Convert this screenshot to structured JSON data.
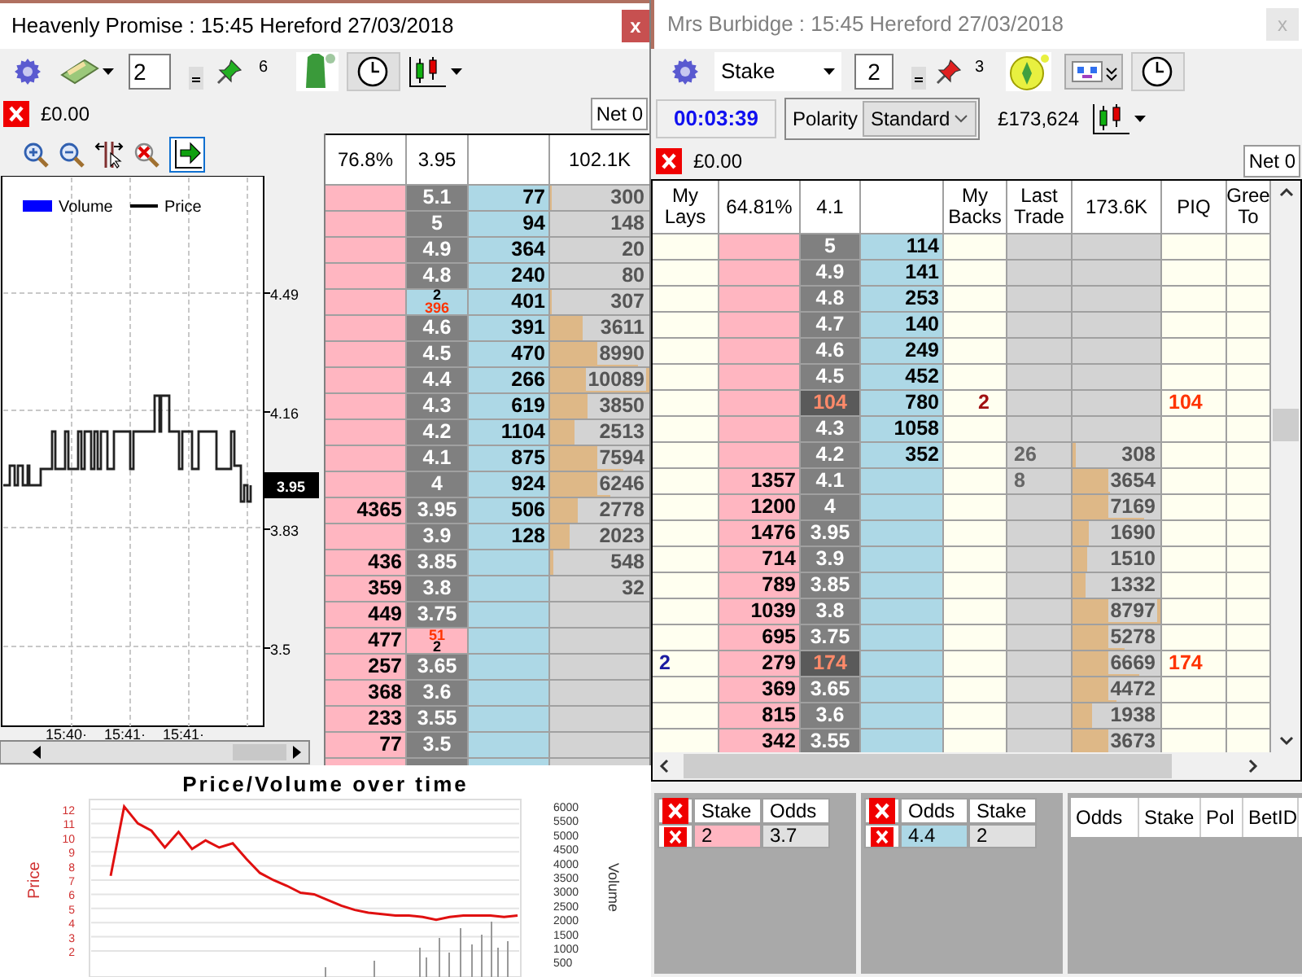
{
  "left_window": {
    "title": "Heavenly Promise : 15:45 Hereford 27/03/2018",
    "close": "x",
    "stake_value": "2",
    "pin_count": "6",
    "exposure": "£0.00",
    "net": "Net 0",
    "chart": {
      "legend": [
        "Volume",
        "Price"
      ],
      "y_ticks": [
        "4.49",
        "4.16",
        "3.83",
        "3.5"
      ],
      "current_price": "3.95",
      "x_ticks": [
        "15:40·",
        "15:41·",
        "15:41·"
      ]
    },
    "ladder": {
      "header": {
        "lay_pct": "76.8%",
        "ltp": "3.95",
        "volume": "102.1K"
      },
      "rows": [
        {
          "odds": {
            "kind": "price",
            "text": "5.1"
          },
          "back": "77",
          "volume": "300",
          "level": 0.02
        },
        {
          "odds": {
            "kind": "price",
            "text": "5"
          },
          "back": "94",
          "volume": "148"
        },
        {
          "odds": {
            "kind": "price",
            "text": "4.9"
          },
          "back": "364",
          "volume": "20"
        },
        {
          "odds": {
            "kind": "price",
            "text": "4.8"
          },
          "back": "240",
          "volume": "80"
        },
        {
          "odds": {
            "kind": "back_order",
            "stake": "2",
            "queue": "396"
          },
          "back": "401",
          "volume": "307",
          "level": 0.02
        },
        {
          "odds": {
            "kind": "price",
            "text": "4.6"
          },
          "back": "391",
          "volume": "3611",
          "level": 0.33
        },
        {
          "odds": {
            "kind": "price",
            "text": "4.5"
          },
          "back": "470",
          "volume": "8990",
          "level": 0.88
        },
        {
          "odds": {
            "kind": "price",
            "text": "4.4"
          },
          "back": "266",
          "volume": "10089",
          "level": 1
        },
        {
          "odds": {
            "kind": "price",
            "text": "4.3"
          },
          "back": "619",
          "volume": "3850",
          "level": 0.37
        },
        {
          "odds": {
            "kind": "price",
            "text": "4.2"
          },
          "back": "1104",
          "volume": "2513",
          "level": 0.24
        },
        {
          "odds": {
            "kind": "price",
            "text": "4.1"
          },
          "back": "875",
          "volume": "7594",
          "level": 0.73
        },
        {
          "odds": {
            "kind": "price",
            "text": "4"
          },
          "back": "924",
          "volume": "6246",
          "level": 0.6
        },
        {
          "lay": "4365",
          "odds": {
            "kind": "price",
            "text": "3.95"
          },
          "back": "506",
          "volume": "2778",
          "level": 0.28
        },
        {
          "odds": {
            "kind": "price",
            "text": "3.9"
          },
          "back": "128",
          "volume": "2023",
          "level": 0.19
        },
        {
          "lay": "436",
          "odds": {
            "kind": "price",
            "text": "3.85"
          },
          "volume": "548",
          "level": 0.04
        },
        {
          "lay": "359",
          "odds": {
            "kind": "price",
            "text": "3.8"
          },
          "volume": "32"
        },
        {
          "lay": "449",
          "odds": {
            "kind": "price",
            "text": "3.75"
          }
        },
        {
          "lay": "477",
          "odds": {
            "kind": "lay_order",
            "stake": "2",
            "queue": "51"
          }
        },
        {
          "lay": "257",
          "odds": {
            "kind": "price",
            "text": "3.65"
          }
        },
        {
          "lay": "368",
          "odds": {
            "kind": "price",
            "text": "3.6"
          }
        },
        {
          "lay": "233",
          "odds": {
            "kind": "price",
            "text": "3.55"
          }
        },
        {
          "lay": "77",
          "odds": {
            "kind": "price",
            "text": "3.5"
          }
        }
      ]
    }
  },
  "right_window": {
    "title": "Mrs Burbidge : 15:45 Hereford 27/03/2018",
    "close": "x",
    "stake_type": "Stake",
    "stake_value": "2",
    "pin_count": "3",
    "timer": "00:03:39",
    "polarity_label": "Polarity",
    "polarity": "Standard",
    "balance": "£173,624",
    "exposure": "£0.00",
    "net": "Net 0",
    "ladder": {
      "header": {
        "my_lays": "My Lays",
        "lay_pct": "64.81%",
        "ltp": "4.1",
        "my_backs": "My Backs",
        "last_trade": "Last Trade",
        "volume": "173.6K",
        "piq": "PIQ",
        "green": "Gree To"
      },
      "rows": [
        {
          "odds": {
            "kind": "price",
            "text": "5"
          },
          "back": "114"
        },
        {
          "odds": {
            "kind": "price",
            "text": "4.9"
          },
          "back": "141"
        },
        {
          "odds": {
            "kind": "price",
            "text": "4.8"
          },
          "back": "253"
        },
        {
          "odds": {
            "kind": "price",
            "text": "4.7"
          },
          "back": "140"
        },
        {
          "odds": {
            "kind": "price",
            "text": "4.6"
          },
          "back": "249"
        },
        {
          "odds": {
            "kind": "price",
            "text": "4.5"
          },
          "back": "452"
        },
        {
          "odds": {
            "kind": "queue",
            "text": "104"
          },
          "back": "780",
          "my_backs": "2",
          "piq": "104"
        },
        {
          "odds": {
            "kind": "price",
            "text": "4.3"
          },
          "back": "1058"
        },
        {
          "odds": {
            "kind": "price",
            "text": "4.2"
          },
          "back": "352",
          "last_trade": "26",
          "volume": "308",
          "level": 0.03
        },
        {
          "lay": "1357",
          "odds": {
            "kind": "price",
            "text": "4.1"
          },
          "last_trade": "8",
          "volume": "3654",
          "level": 0.42
        },
        {
          "lay": "1200",
          "odds": {
            "kind": "price",
            "text": "4"
          },
          "volume": "7169",
          "level": 0.81
        },
        {
          "lay": "1476",
          "odds": {
            "kind": "price",
            "text": "3.95"
          },
          "volume": "1690",
          "level": 0.19
        },
        {
          "lay": "714",
          "odds": {
            "kind": "price",
            "text": "3.9"
          },
          "volume": "1510",
          "level": 0.17
        },
        {
          "lay": "789",
          "odds": {
            "kind": "price",
            "text": "3.85"
          },
          "volume": "1332",
          "level": 0.15
        },
        {
          "lay": "1039",
          "odds": {
            "kind": "price",
            "text": "3.8"
          },
          "volume": "8797",
          "level": 1
        },
        {
          "lay": "695",
          "odds": {
            "kind": "price",
            "text": "3.75"
          },
          "volume": "5278",
          "level": 0.6
        },
        {
          "my_lays": "2",
          "lay": "279",
          "odds": {
            "kind": "queue",
            "text": "174"
          },
          "volume": "6669",
          "level": 0.75,
          "piq": "174"
        },
        {
          "lay": "369",
          "odds": {
            "kind": "price",
            "text": "3.65"
          },
          "volume": "4472",
          "level": 0.5
        },
        {
          "lay": "815",
          "odds": {
            "kind": "price",
            "text": "3.6"
          },
          "volume": "1938",
          "level": 0.22
        },
        {
          "lay": "342",
          "odds": {
            "kind": "price",
            "text": "3.55"
          },
          "volume": "3673",
          "level": 0.42
        }
      ]
    }
  },
  "price_volume_chart": {
    "chart_data": {
      "type": "line",
      "title": "Price/Volume over time",
      "ylabel": "Price",
      "ylim": [
        0.16,
        12.69
      ],
      "yticks": [
        12,
        11,
        10,
        9,
        8,
        7,
        6,
        5,
        4,
        3,
        2
      ],
      "grid": true,
      "values": [
        7.3,
        12.2,
        11,
        10.5,
        9.3,
        10.4,
        9.2,
        9.8,
        9.3,
        9.6,
        8.5,
        7.5,
        7,
        6.6,
        6.1,
        6,
        5.6,
        5.2,
        4.9,
        4.7,
        4.6,
        4.5,
        4.5,
        4.4,
        4.2,
        4.4,
        4.5,
        4.5,
        4.5,
        4.4,
        4.5
      ]
    },
    "volume_axis": {
      "label": "Volume",
      "ticks": [
        "6000",
        "5500",
        "5000",
        "4500",
        "4000",
        "3500",
        "3000",
        "2500",
        "2000",
        "1500",
        "1000",
        "500"
      ]
    }
  },
  "order_panels": [
    {
      "kind": "lay",
      "columns": [
        "Stake",
        "Odds"
      ],
      "rows": [
        {
          "stake": "2",
          "odds": "3.7"
        }
      ]
    },
    {
      "kind": "back",
      "columns": [
        "Odds",
        "Stake"
      ],
      "rows": [
        {
          "odds": "4.4",
          "stake": "2"
        }
      ]
    }
  ],
  "bets_table": {
    "columns": [
      "Odds",
      "Stake",
      "Pol",
      "BetID"
    ]
  }
}
